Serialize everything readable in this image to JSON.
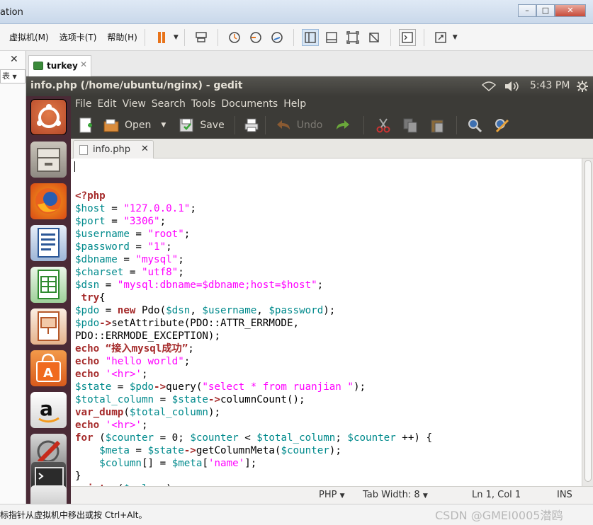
{
  "host": {
    "title_fragment": "ation",
    "menus": [
      "虚拟机(M)",
      "选项卡(T)",
      "帮助(H)"
    ],
    "vm_tab": "turkey",
    "status_message": "标指针从虚拟机中移出或按 Ctrl+Alt。",
    "watermark": "CSDN @GMEI0005潜鸥"
  },
  "guest": {
    "window_title": "info.php (/home/ubuntu/nginx) - gedit",
    "clock": "5:43 PM",
    "menu": [
      "File",
      "Edit",
      "View",
      "Search",
      "Tools",
      "Documents",
      "Help"
    ],
    "toolbar": {
      "open": "Open",
      "save": "Save",
      "undo": "Undo"
    },
    "tab": "info.php",
    "status": {
      "lang": "PHP",
      "tab_width": "Tab Width: 8",
      "position": "Ln 1, Col 1",
      "mode": "INS"
    }
  },
  "code": [
    "",
    "<?php",
    "$host = \"127.0.0.1\";",
    "$port = \"3306\";",
    "$username = \"root\";",
    "$password = \"1\";",
    "$dbname = \"mysql\";",
    "$charset = \"utf8\";",
    "$dsn = \"mysql:dbname=$dbname;host=$host\";",
    " try{",
    "$pdo = new Pdo($dsn, $username, $password);",
    "$pdo->setAttribute(PDO::ATTR_ERRMODE,",
    "PDO::ERRMODE_EXCEPTION);",
    "echo “接入mysql成功”;",
    "echo \"hello world\";",
    "echo '<hr>';",
    "$state = $pdo->query(\"select * from ruanjian \");",
    "$total_column = $state->columnCount();",
    "var_dump($total_column);",
    "echo '<hr>';",
    "for ($counter = 0; $counter < $total_column; $counter ++) {",
    "    $meta = $state->getColumnMeta($counter);",
    "    $column[] = $meta['name'];",
    "}",
    "print_r($column);"
  ]
}
